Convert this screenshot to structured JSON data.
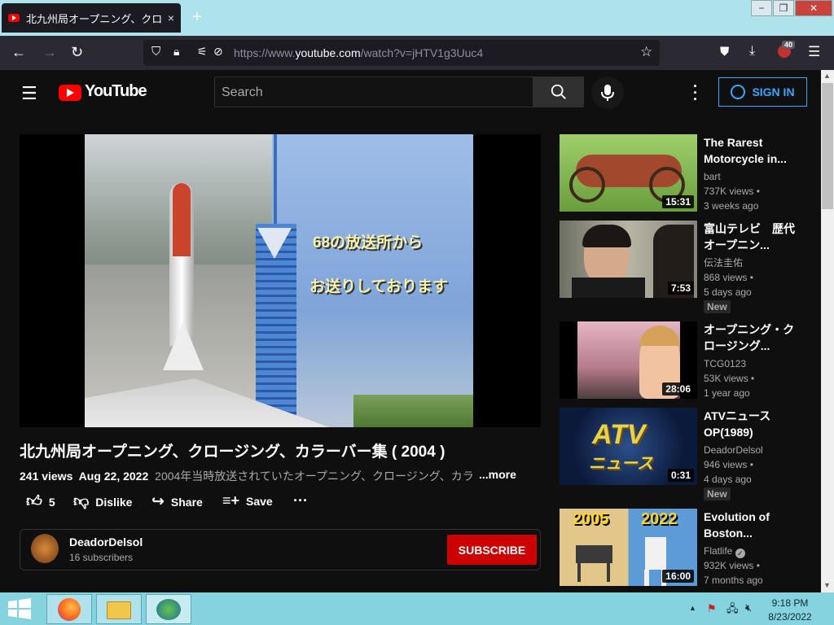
{
  "browser": {
    "tab_title": "北九州局オープニング、クロージ",
    "tab_close": "×",
    "new_tab": "+",
    "window_controls": {
      "minimize": "−",
      "restore": "❐",
      "close": "✕"
    },
    "url_prefix": "https://www.",
    "url_domain": "youtube.com",
    "url_rest": "/watch?v=jHTV1g3Uuc4",
    "extension_badge": "40"
  },
  "youtube": {
    "logo_text": "YouTube",
    "search_placeholder": "Search",
    "sign_in": "SIGN IN"
  },
  "video": {
    "overlay_line1": "68の放送所から",
    "overlay_line2": "お送りしております",
    "title": "北九州局オープニング、クロージング、カラーバー集 ( 2004 )",
    "views": "241 views",
    "date": "Aug 22, 2022",
    "description": "2004年当時放送されていたオープニング、クロージング、カラ",
    "more": "...more",
    "likes": "5",
    "dislike": "Dislike",
    "share": "Share",
    "save": "Save",
    "more_actions": "···"
  },
  "channel": {
    "name": "DeadorDelsol",
    "subscribers": "16 subscribers",
    "subscribe": "SUBSCRIBE"
  },
  "recommendations": [
    {
      "title": "The Rarest Motorcycle in...",
      "channel": "bart",
      "views": "737K views •",
      "age": "3 weeks ago",
      "duration": "15:31",
      "badge": ""
    },
    {
      "title": "富山テレビ　歴代オープニン...",
      "channel": "伝法圭佑",
      "views": "868 views •",
      "age": "5 days ago",
      "duration": "7:53",
      "badge": "New"
    },
    {
      "title": "オープニング・クロージング...",
      "channel": "TCG0123",
      "views": "53K views •",
      "age": "1 year ago",
      "duration": "28:06",
      "badge": ""
    },
    {
      "title": "ATVニュース OP(1989)",
      "channel": "DeadorDelsol",
      "views": "946 views •",
      "age": "4 days ago",
      "duration": "0:31",
      "badge": "New"
    },
    {
      "title": "Evolution of Boston...",
      "channel": "Flatlife",
      "views": "932K views •",
      "age": "7 months ago",
      "duration": "16:00",
      "badge": ""
    }
  ],
  "thumb_text": {
    "atv": "ATV",
    "atv_sub": "ニュース",
    "year_a": "2005",
    "year_b": "2022"
  },
  "taskbar": {
    "time": "9:18 PM",
    "date": "8/23/2022"
  }
}
